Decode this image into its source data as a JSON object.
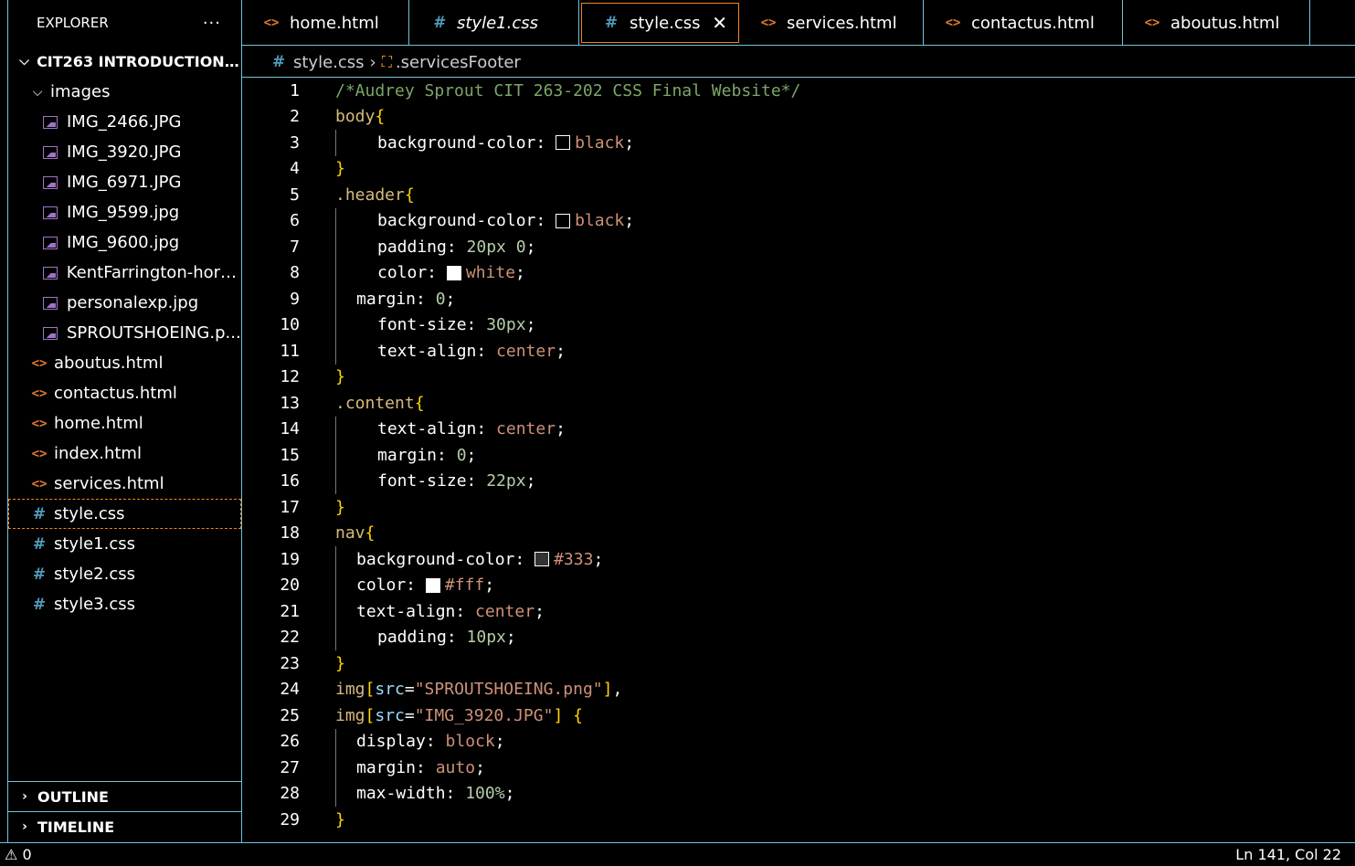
{
  "sidebar": {
    "title": "EXPLORER",
    "more": "···",
    "root": "CIT263 INTRODUCTION T...",
    "folder": "images",
    "images": [
      "IMG_2466.JPG",
      "IMG_3920.JPG",
      "IMG_6971.JPG",
      "IMG_9599.jpg",
      "IMG_9600.jpg",
      "KentFarrington-hors...",
      "personalexp.jpg",
      "SPROUTSHOEING.p..."
    ],
    "html_files": [
      "aboutus.html",
      "contactus.html",
      "home.html",
      "index.html",
      "services.html"
    ],
    "css_files": [
      "style.css",
      "style1.css",
      "style2.css",
      "style3.css"
    ],
    "outline": "OUTLINE",
    "timeline": "TIMELINE"
  },
  "tabs": [
    {
      "label": "home.html",
      "type": "html"
    },
    {
      "label": "style1.css",
      "type": "css"
    },
    {
      "label": "style.css",
      "type": "css"
    },
    {
      "label": "services.html",
      "type": "html"
    },
    {
      "label": "contactus.html",
      "type": "html"
    },
    {
      "label": "aboutus.html",
      "type": "html"
    }
  ],
  "breadcrumb": {
    "file": "style.css",
    "symbol": ".servicesFooter"
  },
  "status": {
    "problems": "0",
    "position": "Ln 141, Col 22"
  },
  "swatch_colors": {
    "black": "#000000",
    "white": "#ffffff",
    "c333": "#333333",
    "cfff": "#ffffff"
  },
  "code": {
    "l1": "/*Audrey Sprout CIT 263-202 CSS Final Website*/",
    "l2s": "body",
    "l3p": "background-color: ",
    "l3v": "black",
    "l5s": ".header",
    "l6p": "background-color: ",
    "l6v": "black",
    "l7p": "padding: ",
    "l7v": "20px 0",
    "l8p": "color: ",
    "l8v": "white",
    "l9p": "margin: ",
    "l9v": "0",
    "l10p": "font-size: ",
    "l10v": "30px",
    "l11p": "text-align: ",
    "l11v": "center",
    "l13s": ".content",
    "l14p": "text-align: ",
    "l14v": "center",
    "l15p": "margin: ",
    "l15v": "0",
    "l16p": "font-size: ",
    "l16v": "22px",
    "l18s": "nav",
    "l19p": "background-color: ",
    "l19v": "#333",
    "l20p": "color: ",
    "l20v": "#fff",
    "l21p": "text-align: ",
    "l21v": "center",
    "l22p": "padding: ",
    "l22v": "10px",
    "l24a": "img",
    "l24b": "src",
    "l24c": "\"SPROUTSHOEING.png\"",
    "l25a": "img",
    "l25b": "src",
    "l25c": "\"IMG_3920.JPG\"",
    "l26p": "display: ",
    "l26v": "block",
    "l27p": "margin: ",
    "l27v": "auto",
    "l28p": "max-width: ",
    "l28v": "100%"
  }
}
